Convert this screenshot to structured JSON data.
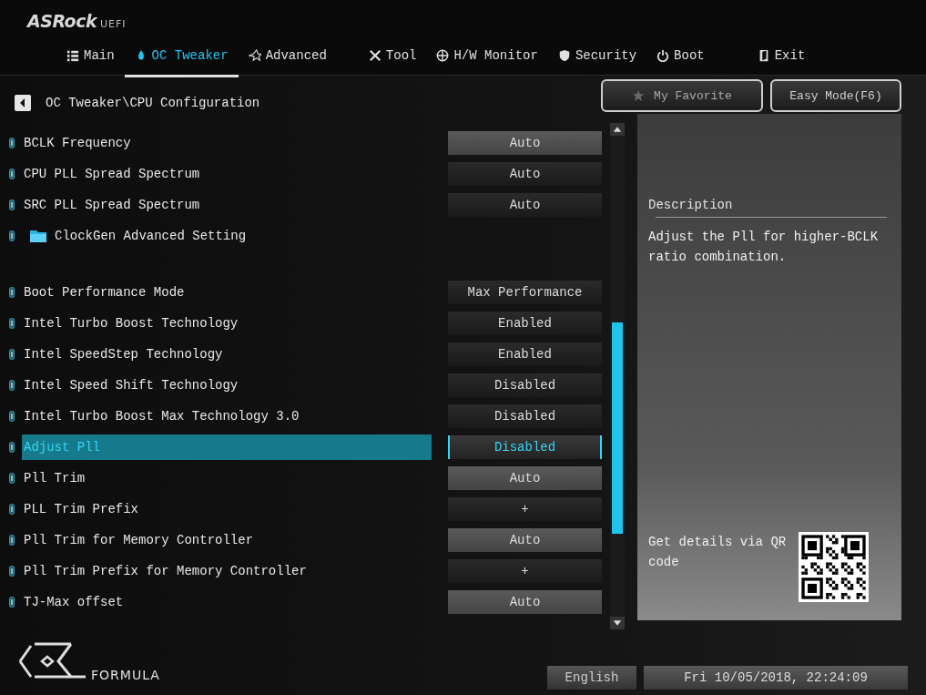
{
  "logo": {
    "brand": "ASRock",
    "product": "UEFI"
  },
  "tabs": [
    {
      "label": "Main",
      "selected": false
    },
    {
      "label": "OC Tweaker",
      "selected": true
    },
    {
      "label": "Advanced",
      "selected": false
    },
    {
      "label": "Tool",
      "selected": false
    },
    {
      "label": "H/W Monitor",
      "selected": false
    },
    {
      "label": "Security",
      "selected": false
    },
    {
      "label": "Boot",
      "selected": false
    },
    {
      "label": "Exit",
      "selected": false
    }
  ],
  "breadcrumb": "OC Tweaker\\CPU Configuration",
  "buttons": {
    "favorite": "My Favorite",
    "easy_mode": "Easy Mode(F6)"
  },
  "settings": [
    {
      "kind": "number",
      "label": "BCLK Frequency",
      "value": "Auto",
      "selected": false
    },
    {
      "kind": "option",
      "label": "CPU PLL Spread Spectrum",
      "value": "Auto",
      "selected": false
    },
    {
      "kind": "option",
      "label": "SRC PLL Spread Spectrum",
      "value": "Auto",
      "selected": false
    },
    {
      "kind": "folder",
      "label": "ClockGen Advanced Setting",
      "selected": false
    },
    {
      "kind": "option",
      "label": "Boot Performance Mode",
      "value": "Max Performance",
      "selected": false
    },
    {
      "kind": "option",
      "label": "Intel Turbo Boost Technology",
      "value": "Enabled",
      "selected": false
    },
    {
      "kind": "option",
      "label": "Intel SpeedStep Technology",
      "value": "Enabled",
      "selected": false
    },
    {
      "kind": "option",
      "label": "Intel Speed Shift Technology",
      "value": "Disabled",
      "selected": false
    },
    {
      "kind": "option",
      "label": "Intel Turbo Boost Max Technology 3.0",
      "value": "Disabled",
      "selected": false
    },
    {
      "kind": "option",
      "label": "Adjust Pll",
      "value": "Disabled",
      "selected": true
    },
    {
      "kind": "number",
      "label": "Pll Trim",
      "value": "Auto",
      "selected": false
    },
    {
      "kind": "option",
      "label": "PLL Trim Prefix",
      "value": "+",
      "selected": false
    },
    {
      "kind": "number",
      "label": "Pll Trim for Memory Controller",
      "value": "Auto",
      "selected": false
    },
    {
      "kind": "option",
      "label": "Pll Trim Prefix for Memory Controller",
      "value": "+",
      "selected": false
    },
    {
      "kind": "number",
      "label": "TJ-Max offset",
      "value": "Auto",
      "selected": false
    }
  ],
  "description": {
    "title": "Description",
    "text": "Adjust the Pll for higher-BCLK ratio combination."
  },
  "qr_hint": "Get details via QR code",
  "footer": {
    "series": "FORMULA",
    "language": "English",
    "datetime": "Fri 10/05/2018, 22:24:09"
  }
}
